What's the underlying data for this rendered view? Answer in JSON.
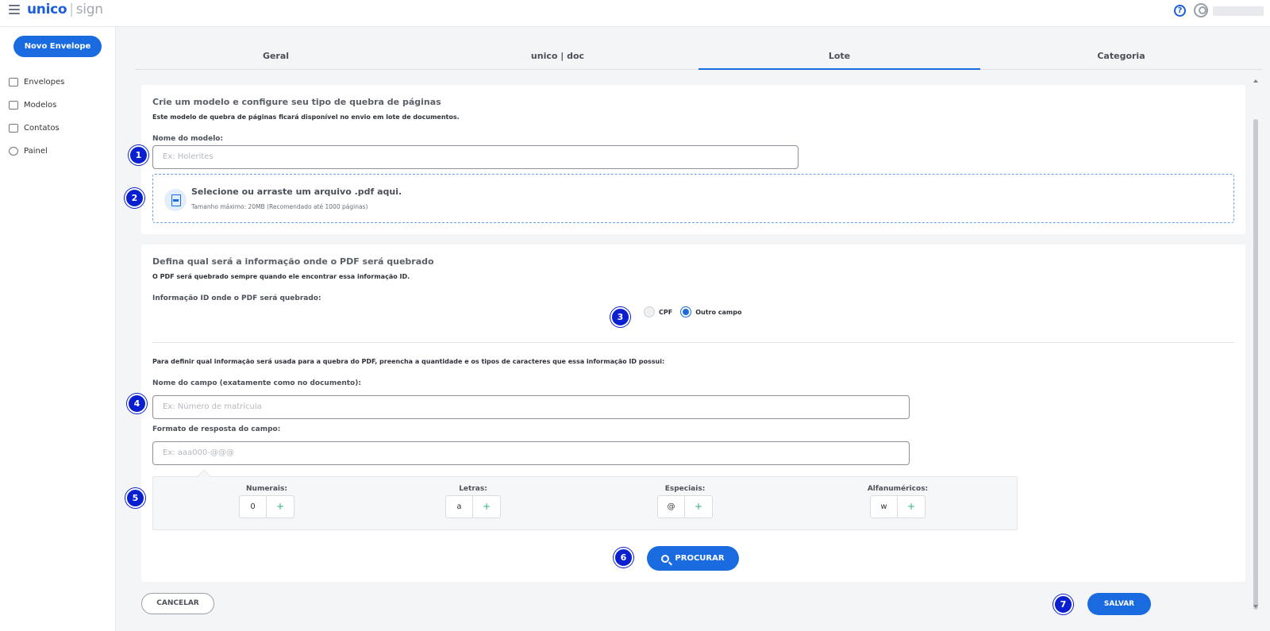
{
  "header": {
    "logo_primary": "unico",
    "logo_separator": "|",
    "logo_secondary": "sign",
    "help_icon": "?"
  },
  "sidebar": {
    "new_button": "Novo Envelope",
    "items": [
      {
        "label": "Envelopes",
        "icon": "envelope-icon"
      },
      {
        "label": "Modelos",
        "icon": "template-icon"
      },
      {
        "label": "Contatos",
        "icon": "contacts-icon"
      },
      {
        "label": "Painel",
        "icon": "chart-icon"
      }
    ]
  },
  "tabs": [
    {
      "label": "Geral",
      "active": false
    },
    {
      "label": "unico | doc",
      "active": false
    },
    {
      "label": "Lote",
      "active": true
    },
    {
      "label": "Categoria",
      "active": false
    }
  ],
  "section1": {
    "title": "Crie um modelo e configure seu tipo de quebra de páginas",
    "subtitle": "Este modelo de quebra de páginas ficará disponível no envio em lote de documentos.",
    "name_label": "Nome do modelo:",
    "name_placeholder": "Ex: Holerites",
    "upload_title": "Selecione ou arraste um arquivo .pdf aqui.",
    "upload_sub": "Tamanho máximo: 20MB (Recomendado até 1000 páginas)"
  },
  "section2": {
    "title": "Defina qual será a informação onde o PDF será quebrado",
    "subtitle": "O PDF será quebrado sempre quando ele encontrar essa informação ID.",
    "id_label": "Informação ID onde o PDF será quebrado:",
    "radio_cpf": "CPF",
    "radio_other": "Outro campo",
    "selected_radio": "Outro campo",
    "instructions": "Para definir qual informação será usada para a quebra do PDF, preencha a quantidade e os tipos de caracteres que essa informação ID possui:",
    "field_name_label": "Nome do campo (exatamente como no documento):",
    "field_name_placeholder": "Ex: Número de matrícula",
    "format_label": "Formato de resposta do campo:",
    "format_placeholder": "Ex: aaa000-@@@",
    "format_types": [
      {
        "label": "Numerais:",
        "symbol": "0",
        "add": "+"
      },
      {
        "label": "Letras:",
        "symbol": "a",
        "add": "+"
      },
      {
        "label": "Especiais:",
        "symbol": "@",
        "add": "+"
      },
      {
        "label": "Alfanuméricos:",
        "symbol": "w",
        "add": "+"
      }
    ],
    "search_button": "PROCURAR"
  },
  "footer": {
    "cancel_button": "CANCELAR",
    "save_button": "SALVAR"
  },
  "badges": [
    "1",
    "2",
    "3",
    "4",
    "5",
    "6",
    "7"
  ],
  "colors": {
    "primary": "#1a6be0",
    "badge": "#0a1fcf",
    "plus": "#2bb673"
  }
}
